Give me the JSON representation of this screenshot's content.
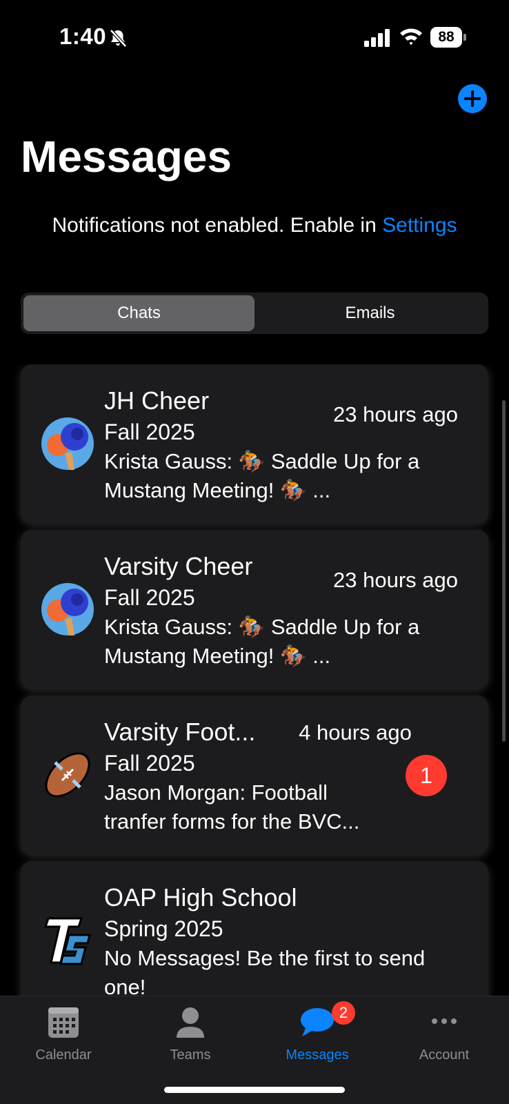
{
  "status_bar": {
    "time": "1:40",
    "battery": "88"
  },
  "header": {
    "title": "Messages",
    "add_icon": "plus-icon",
    "notice_text": "Notifications not enabled. Enable in ",
    "notice_link": "Settings"
  },
  "segments": {
    "chats": "Chats",
    "emails": "Emails",
    "selected": "Chats"
  },
  "chats": [
    {
      "name": "JH Cheer",
      "season": "Fall 2025",
      "preview": "Krista Gauss: 🏇 Saddle Up for a Mustang Meeting! 🏇 ...",
      "time": "23 hours ago",
      "avatar": "pompom-avatar"
    },
    {
      "name": "Varsity Cheer",
      "season": "Fall 2025",
      "preview": "Krista Gauss: 🏇 Saddle Up for a Mustang Meeting! 🏇 ...",
      "time": "23 hours ago",
      "avatar": "pompom-avatar"
    },
    {
      "name": "Varsity Foot...",
      "season": "Fall 2025",
      "preview": "Jason Morgan: Football tranfer forms for the BVC...",
      "time": "4 hours ago",
      "unread": "1",
      "avatar": "football-avatar"
    },
    {
      "name": "OAP High School",
      "season": "Spring 2025",
      "preview": "No Messages! Be the first to send one!",
      "avatar": "ts-logo-avatar"
    }
  ],
  "tab_bar": {
    "calendar": "Calendar",
    "teams": "Teams",
    "messages": "Messages",
    "account": "Account",
    "messages_badge": "2",
    "active": "Messages"
  },
  "colors": {
    "accent": "#0a84ff",
    "badge": "#ff3b30",
    "card": "#1c1c1e",
    "background": "#000000"
  }
}
